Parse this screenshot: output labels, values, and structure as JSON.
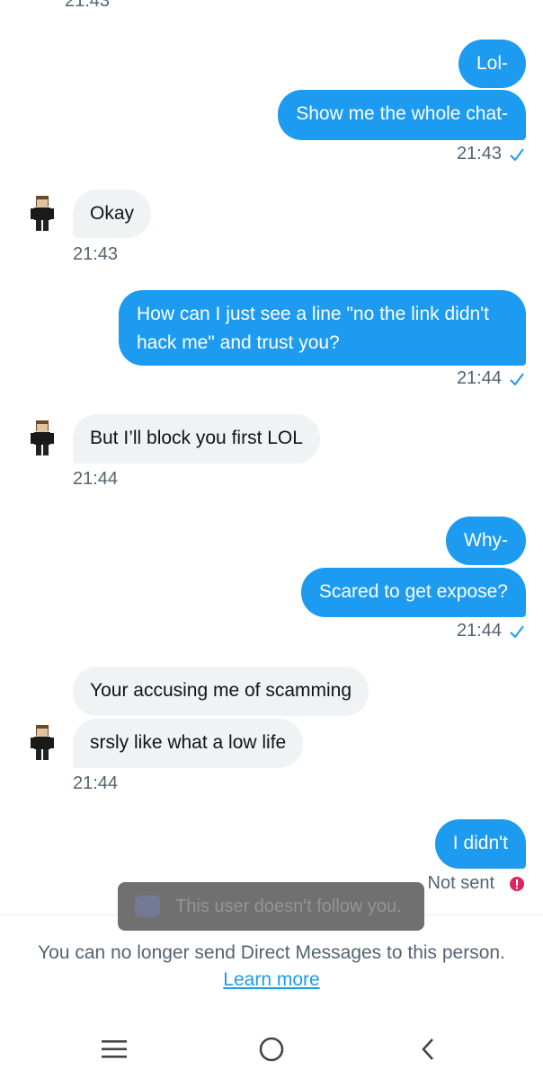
{
  "top_timestamp": "21:43",
  "messages": [
    {
      "text": "Lol-"
    },
    {
      "text": "Show me the whole chat-"
    },
    {
      "time": "21:43"
    },
    {
      "text": "Okay",
      "time": "21:43"
    },
    {
      "text": "How can I just see a line \"no the link didn't hack me\" and trust you?",
      "time": "21:44"
    },
    {
      "text": "But I’ll block you first LOL",
      "time": "21:44"
    },
    {
      "text": "Why-"
    },
    {
      "text": "Scared to get expose?",
      "time": "21:44"
    },
    {
      "text": "Your accusing me of scamming"
    },
    {
      "text": "srsly like what a low life",
      "time": "21:44"
    },
    {
      "text": "I didn't",
      "status": "Not sent"
    }
  ],
  "toast": {
    "text": "This user doesn't follow you."
  },
  "footer": {
    "notice": "You can no longer send Direct Messages to this person.",
    "link": "Learn more"
  },
  "colors": {
    "accent": "#1d9bf0",
    "incoming_bubble": "#eff3f4",
    "error": "#e0245e"
  },
  "icons": [
    "check-icon",
    "error-icon",
    "avatar-icon",
    "menu-icon",
    "home-circle-icon",
    "back-chevron-icon"
  ]
}
